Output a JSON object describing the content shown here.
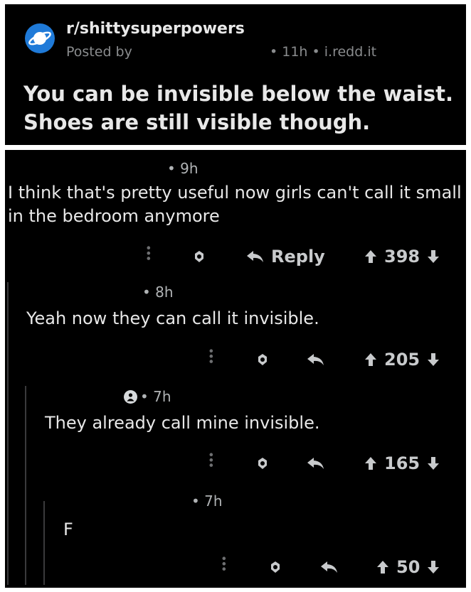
{
  "post": {
    "subreddit": "r/shittysuperpowers",
    "posted_by": "Posted by",
    "meta": "• 11h • i.redd.it",
    "title": "You can be invisible below the waist. Shoes are still visible though."
  },
  "comments": [
    {
      "time": "• 9h",
      "body": "I think that's pretty useful now girls can't call it small in the bedroom anymore",
      "reply_label": "Reply",
      "score": "398"
    },
    {
      "time": "• 8h",
      "body": "Yeah now they can call it invisible.",
      "score": "205"
    },
    {
      "time": "• 7h",
      "body": "They already call mine invisible.",
      "score": "165"
    },
    {
      "time": "• 7h",
      "body": "F",
      "score": "50"
    }
  ],
  "icons": {
    "subreddit": "planet-icon",
    "more": "more-dots-icon",
    "award": "award-icon",
    "reply": "reply-arrow-icon",
    "upvote": "upvote-arrow-icon",
    "downvote": "downvote-arrow-icon"
  }
}
